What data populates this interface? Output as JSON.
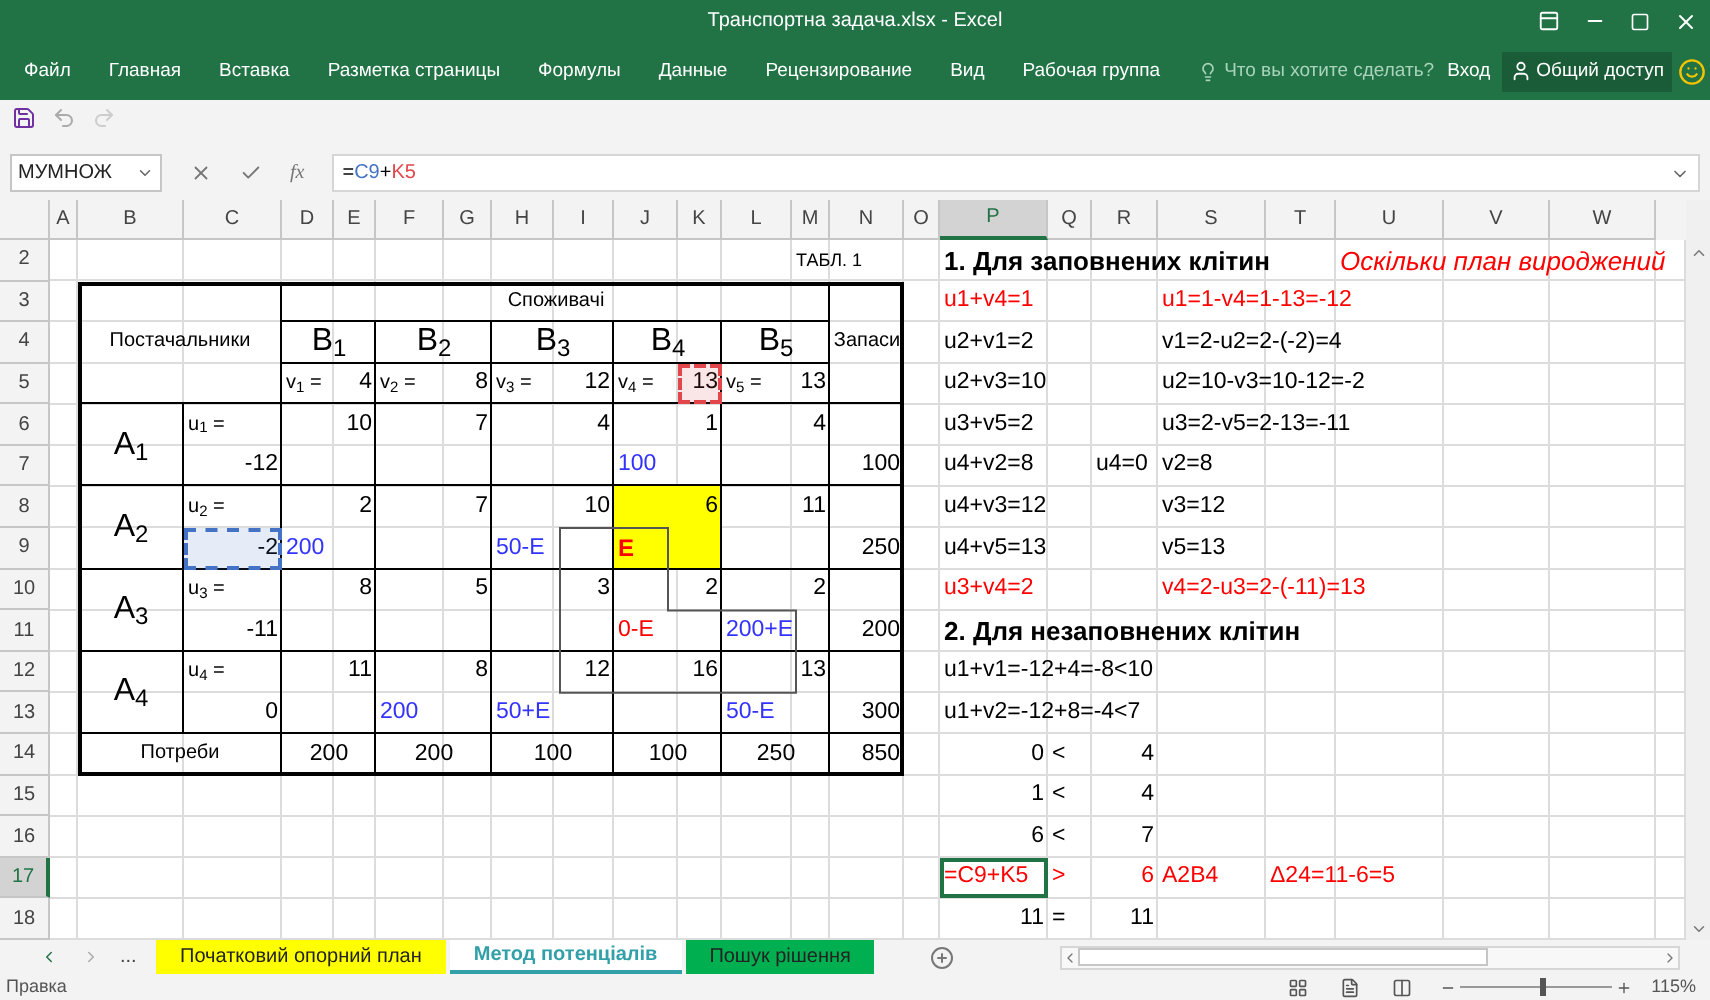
{
  "window": {
    "title": "Транспортна задача.xlsx - Excel"
  },
  "ribbon_tabs": [
    {
      "label": "Файл"
    },
    {
      "label": "Главная"
    },
    {
      "label": "Вставка"
    },
    {
      "label": "Разметка страницы"
    },
    {
      "label": "Формулы"
    },
    {
      "label": "Данные"
    },
    {
      "label": "Рецензирование"
    },
    {
      "label": "Вид"
    },
    {
      "label": "Рабочая группа"
    }
  ],
  "tell_me": {
    "placeholder": "Что вы хотите сделать?"
  },
  "sign_in": "Вход",
  "share": "Общий доступ",
  "name_box": "МУМНОЖ",
  "fx_label": "fx",
  "formula": [
    {
      "text": "="
    },
    {
      "text": "C9",
      "color": "#4472c4"
    },
    {
      "text": "+"
    },
    {
      "text": "K5",
      "color": "#e0464a"
    }
  ],
  "columns": [
    {
      "label": "A",
      "selected": false
    },
    {
      "label": "B",
      "selected": false
    },
    {
      "label": "C",
      "selected": false
    },
    {
      "label": "D",
      "selected": false
    },
    {
      "label": "E",
      "selected": false
    },
    {
      "label": "F",
      "selected": false
    },
    {
      "label": "G",
      "selected": false
    },
    {
      "label": "H",
      "selected": false
    },
    {
      "label": "I",
      "selected": false
    },
    {
      "label": "J",
      "selected": false
    },
    {
      "label": "K",
      "selected": false
    },
    {
      "label": "L",
      "selected": false
    },
    {
      "label": "M",
      "selected": false
    },
    {
      "label": "N",
      "selected": false
    },
    {
      "label": "O",
      "selected": false
    },
    {
      "label": "P",
      "selected": true
    },
    {
      "label": "Q",
      "selected": false
    },
    {
      "label": "R",
      "selected": false
    },
    {
      "label": "S",
      "selected": false
    },
    {
      "label": "T",
      "selected": false
    },
    {
      "label": "U",
      "selected": false
    },
    {
      "label": "V",
      "selected": false
    },
    {
      "label": "W",
      "selected": false
    }
  ],
  "rows": [
    {
      "label": "2",
      "selected": false,
      "cells": [
        null,
        null,
        null,
        null,
        null,
        null,
        null,
        null,
        null,
        null,
        null,
        null,
        {
          "text": "ТАБЛ. 1",
          "kind": "small"
        },
        null,
        null,
        {
          "text": "1. Для заповнених клітин",
          "kind": "bold"
        },
        null,
        null,
        null,
        null,
        {
          "text": "Оскільки план вироджений",
          "kind": "note",
          "color": "#ff0000"
        },
        null,
        null
      ]
    },
    {
      "label": "3",
      "selected": false,
      "cells": [
        null,
        null,
        null,
        {
          "text": "Споживачі",
          "kind": "caption"
        },
        null,
        null,
        null,
        null,
        null,
        null,
        null,
        null,
        null,
        null,
        null,
        {
          "text": "u1+v4=1",
          "kind": "text",
          "color": "#ff0000"
        },
        null,
        null,
        {
          "text": "u1=1-v4=1-13=-12",
          "kind": "text",
          "color": "#ff0000"
        },
        null,
        null,
        null,
        null
      ]
    },
    {
      "label": "4",
      "selected": false,
      "cells": [
        null,
        {
          "text": "Постачальники",
          "kind": "caption"
        },
        null,
        {
          "text": "B$_{1}$",
          "kind": "header"
        },
        null,
        {
          "text": "B$_{2}$",
          "kind": "header"
        },
        null,
        {
          "text": "B$_{3}$",
          "kind": "header"
        },
        null,
        {
          "text": "B$_{4}$",
          "kind": "header"
        },
        null,
        {
          "text": "B$_{5}$",
          "kind": "header"
        },
        null,
        {
          "text": "Запаси",
          "kind": "caption"
        },
        null,
        {
          "text": "u2+v1=2",
          "kind": "text"
        },
        null,
        null,
        {
          "text": "v1=2-u2=2-(-2)=4",
          "kind": "text"
        },
        null,
        null,
        null,
        null
      ]
    },
    {
      "label": "5",
      "selected": false,
      "cells": [
        null,
        null,
        null,
        {
          "text": "v$_{1}$ =",
          "kind": "label"
        },
        {
          "text": "4",
          "kind": "number"
        },
        {
          "text": "v$_{2}$ =",
          "kind": "label"
        },
        {
          "text": "8",
          "kind": "number"
        },
        {
          "text": "v$_{3}$ =",
          "kind": "label"
        },
        {
          "text": "12",
          "kind": "number"
        },
        {
          "text": "v$_{4}$ =",
          "kind": "label"
        },
        {
          "text": "13",
          "kind": "number"
        },
        {
          "text": "v$_{5}$ =",
          "kind": "label"
        },
        {
          "text": "13",
          "kind": "number"
        },
        null,
        null,
        {
          "text": "u2+v3=10",
          "kind": "text"
        },
        null,
        null,
        {
          "text": "u2=10-v3=10-12=-2",
          "kind": "text"
        },
        null,
        null,
        null,
        null
      ]
    },
    {
      "label": "6",
      "selected": false,
      "cells": [
        null,
        {
          "text": "A$_{1}$",
          "kind": "header"
        },
        {
          "text": "u$_{1}$ =",
          "kind": "label"
        },
        null,
        {
          "text": "10",
          "kind": "number"
        },
        null,
        {
          "text": "7",
          "kind": "number"
        },
        null,
        {
          "text": "4",
          "kind": "number"
        },
        null,
        {
          "text": "1",
          "kind": "number"
        },
        null,
        {
          "text": "4",
          "kind": "number"
        },
        null,
        null,
        {
          "text": "u3+v5=2",
          "kind": "text"
        },
        null,
        null,
        {
          "text": "u3=2-v5=2-13=-11",
          "kind": "text"
        },
        null,
        null,
        null,
        null
      ]
    },
    {
      "label": "7",
      "selected": false,
      "cells": [
        null,
        null,
        {
          "text": "-12",
          "kind": "number"
        },
        null,
        null,
        null,
        null,
        null,
        null,
        {
          "text": "100",
          "kind": "text",
          "color": "#3333ff"
        },
        null,
        null,
        null,
        {
          "text": "100",
          "kind": "number"
        },
        null,
        {
          "text": "u4+v2=8",
          "kind": "text"
        },
        null,
        {
          "text": "u4=0",
          "kind": "text"
        },
        {
          "text": "v2=8",
          "kind": "text"
        },
        null,
        null,
        null,
        null
      ]
    },
    {
      "label": "8",
      "selected": false,
      "cells": [
        null,
        {
          "text": "A$_{2}$",
          "kind": "header"
        },
        {
          "text": "u$_{2}$ =",
          "kind": "label"
        },
        null,
        {
          "text": "2",
          "kind": "number"
        },
        null,
        {
          "text": "7",
          "kind": "number"
        },
        null,
        {
          "text": "10",
          "kind": "number"
        },
        null,
        {
          "text": "6",
          "kind": "highlighted"
        },
        null,
        {
          "text": "11",
          "kind": "number"
        },
        null,
        null,
        {
          "text": "u4+v3=12",
          "kind": "text"
        },
        null,
        null,
        {
          "text": "v3=12",
          "kind": "text"
        },
        null,
        null,
        null,
        null
      ]
    },
    {
      "label": "9",
      "selected": false,
      "cells": [
        null,
        null,
        {
          "text": "-2",
          "kind": "number"
        },
        {
          "text": "200",
          "kind": "text",
          "color": "#3333ff"
        },
        null,
        null,
        null,
        {
          "text": "50-E",
          "kind": "text",
          "color": "#3333ff"
        },
        null,
        {
          "text": "E",
          "kind": "strong",
          "color": "#ff0000"
        },
        null,
        null,
        null,
        {
          "text": "250",
          "kind": "number"
        },
        null,
        {
          "text": "u4+v5=13",
          "kind": "text"
        },
        null,
        null,
        {
          "text": "v5=13",
          "kind": "text"
        },
        null,
        null,
        null,
        null
      ]
    },
    {
      "label": "10",
      "selected": false,
      "cells": [
        null,
        {
          "text": "A$_{3}$",
          "kind": "header"
        },
        {
          "text": "u$_{3}$ =",
          "kind": "label"
        },
        null,
        {
          "text": "8",
          "kind": "number"
        },
        null,
        {
          "text": "5",
          "kind": "number"
        },
        null,
        {
          "text": "3",
          "kind": "number"
        },
        null,
        {
          "text": "2",
          "kind": "number"
        },
        null,
        {
          "text": "2",
          "kind": "number"
        },
        null,
        null,
        {
          "text": "u3+v4=2",
          "kind": "text",
          "color": "#ff0000"
        },
        null,
        null,
        {
          "text": "v4=2-u3=2-(-11)=13",
          "kind": "text",
          "color": "#ff0000"
        },
        null,
        null,
        null,
        null
      ]
    },
    {
      "label": "11",
      "selected": false,
      "cells": [
        null,
        null,
        {
          "text": "-11",
          "kind": "number"
        },
        null,
        null,
        null,
        null,
        null,
        null,
        {
          "text": "0-E",
          "kind": "text",
          "color": "#ff0000"
        },
        null,
        {
          "text": "200+E",
          "kind": "text",
          "color": "#3333ff"
        },
        null,
        {
          "text": "200",
          "kind": "number"
        },
        null,
        {
          "text": "2. Для незаповнених клітин",
          "kind": "bold"
        },
        null,
        null,
        null,
        null,
        null,
        null,
        null
      ]
    },
    {
      "label": "12",
      "selected": false,
      "cells": [
        null,
        {
          "text": "A$_{4}$",
          "kind": "header"
        },
        {
          "text": "u$_{4}$ =",
          "kind": "label"
        },
        null,
        {
          "text": "11",
          "kind": "number"
        },
        null,
        {
          "text": "8",
          "kind": "number"
        },
        null,
        {
          "text": "12",
          "kind": "number"
        },
        null,
        {
          "text": "16",
          "kind": "number"
        },
        null,
        {
          "text": "13",
          "kind": "number"
        },
        null,
        null,
        {
          "text": "u1+v1=-12+4=-8<10",
          "kind": "text"
        },
        null,
        null,
        null,
        null,
        null,
        null,
        null
      ]
    },
    {
      "label": "13",
      "selected": false,
      "cells": [
        null,
        null,
        {
          "text": "0",
          "kind": "number"
        },
        null,
        null,
        {
          "text": "200",
          "kind": "text",
          "color": "#3333ff"
        },
        null,
        {
          "text": "50+E",
          "kind": "text",
          "color": "#3333ff"
        },
        null,
        null,
        null,
        {
          "text": "50-E",
          "kind": "text",
          "color": "#3333ff"
        },
        null,
        {
          "text": "300",
          "kind": "number"
        },
        null,
        {
          "text": "u1+v2=-12+8=-4<7",
          "kind": "text"
        },
        null,
        null,
        null,
        null,
        null,
        null,
        null
      ]
    },
    {
      "label": "14",
      "selected": false,
      "cells": [
        null,
        {
          "text": "Потреби",
          "kind": "caption"
        },
        null,
        {
          "text": "200",
          "kind": "center"
        },
        null,
        {
          "text": "200",
          "kind": "center"
        },
        null,
        {
          "text": "100",
          "kind": "center"
        },
        null,
        {
          "text": "100",
          "kind": "center"
        },
        null,
        {
          "text": "250",
          "kind": "center"
        },
        null,
        {
          "text": "850",
          "kind": "number"
        },
        null,
        {
          "text": "0",
          "kind": "number"
        },
        {
          "text": "<",
          "kind": "text"
        },
        {
          "text": "4",
          "kind": "number"
        },
        null,
        null,
        null,
        null,
        null
      ]
    },
    {
      "label": "15",
      "selected": false,
      "cells": [
        null,
        null,
        null,
        null,
        null,
        null,
        null,
        null,
        null,
        null,
        null,
        null,
        null,
        null,
        null,
        {
          "text": "1",
          "kind": "number"
        },
        {
          "text": "<",
          "kind": "text"
        },
        {
          "text": "4",
          "kind": "number"
        },
        null,
        null,
        null,
        null,
        null
      ]
    },
    {
      "label": "16",
      "selected": false,
      "cells": [
        null,
        null,
        null,
        null,
        null,
        null,
        null,
        null,
        null,
        null,
        null,
        null,
        null,
        null,
        null,
        {
          "text": "6",
          "kind": "number"
        },
        {
          "text": "<",
          "kind": "text"
        },
        {
          "text": "7",
          "kind": "number"
        },
        null,
        null,
        null,
        null,
        null
      ]
    },
    {
      "label": "17",
      "selected": true,
      "cells": [
        null,
        null,
        null,
        null,
        null,
        null,
        null,
        null,
        null,
        null,
        null,
        null,
        null,
        null,
        null,
        {
          "text": "=C9+K5",
          "kind": "text",
          "color": "#ff0000"
        },
        {
          "text": ">",
          "kind": "text",
          "color": "#ff0000"
        },
        {
          "text": "6",
          "kind": "number",
          "color": "#ff0000"
        },
        {
          "text": "A2B4",
          "kind": "text",
          "color": "#ff0000"
        },
        {
          "text": "Δ24=11-6=5",
          "kind": "text",
          "color": "#ff0000"
        },
        null,
        null,
        null
      ]
    },
    {
      "label": "18",
      "selected": false,
      "cells": [
        null,
        null,
        null,
        null,
        null,
        null,
        null,
        null,
        null,
        null,
        null,
        null,
        null,
        null,
        null,
        {
          "text": "11",
          "kind": "number"
        },
        {
          "text": "=",
          "kind": "text"
        },
        {
          "text": "11",
          "kind": "number"
        },
        null,
        null,
        null,
        null,
        null
      ]
    }
  ],
  "sheet_nav_more": "...",
  "sheet_tabs": [
    {
      "label": "Початковий опорний план",
      "selected": false,
      "color": "#ffff00"
    },
    {
      "label": "Метод потенціалів",
      "selected": true,
      "color": "#31a0a8"
    },
    {
      "label": "Пошук рішення",
      "selected": false,
      "color": "#00b050"
    }
  ],
  "status": "Правка",
  "zoom_slider": {
    "level": 0.55
  },
  "zoom": "115%"
}
